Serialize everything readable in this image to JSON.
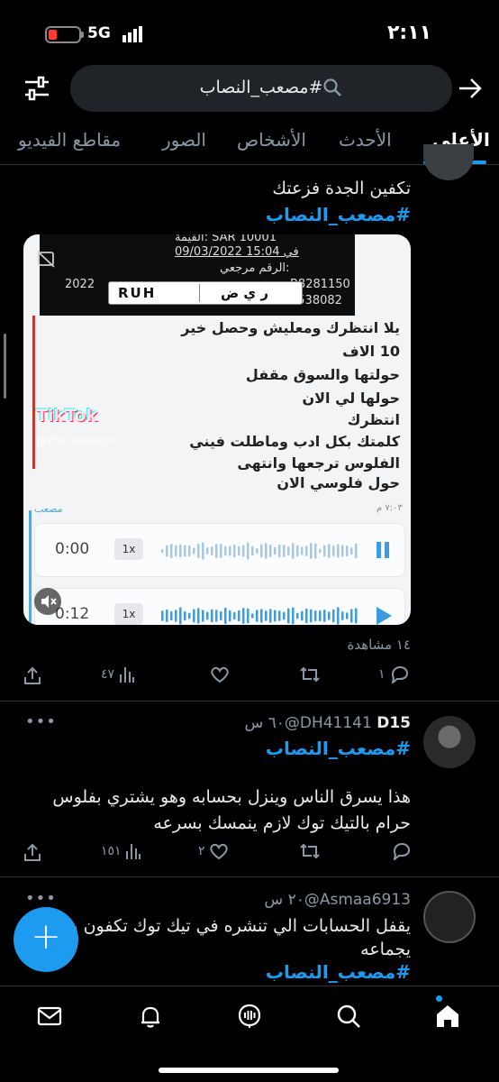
{
  "status": {
    "time": "٢:١١",
    "network": "5G"
  },
  "search": {
    "query": "#مصعب_النصاب"
  },
  "tabs": [
    {
      "label": "الأعلى"
    },
    {
      "label": "الأحدث"
    },
    {
      "label": "الأشخاص"
    },
    {
      "label": "الصور"
    },
    {
      "label": "مقاطع الفيديو"
    }
  ],
  "tweet1": {
    "text": "تكفين الجدة فزعتك",
    "hashtag": "#مصعب_النصاب",
    "media": {
      "receipt_lines": [
        "القيمة: SAR 10001",
        "في 15:04 09/03/2022",
        "الرقم مرجعي:",
        "B8281150",
        "4538082"
      ],
      "plate_year": "2022",
      "plate_latin": "RUH",
      "plate_arabic": "ر ي ض",
      "chat_lines": [
        "يلا انتظرك ومعليش وحصل خير",
        "10 الاف",
        "حولتها والسوق مقفل",
        "حولها لي الان",
        "انتظرك",
        "كلمتك بكل ادب وماطلت فيني",
        "الفلوس ترجعها وانتهى",
        "حول فلوسي الان"
      ],
      "watermark": "TikTok",
      "watermark_user": "@zhir.dilaaajmi",
      "chat_sender": "مصعب",
      "chat_time": "٧:٠٣ م",
      "voice_notes": [
        {
          "time": "0:00",
          "speed": "1x",
          "state": "pause"
        },
        {
          "time": "0:12",
          "speed": "1x",
          "state": "play"
        }
      ]
    },
    "views": "١٤ مشاهدة",
    "actions": {
      "replies": "١",
      "retweets": "",
      "likes": "",
      "views": "٤٧"
    }
  },
  "tweet2": {
    "name": "D15",
    "handle": "@DH41141",
    "time": "٦٠ س",
    "hashtag": "#مصعب_النصاب",
    "text_line1": "هذا يسرق الناس وينزل بحسابه وهو يشتري بفلوس",
    "text_line2": "حرام بالتيك توك لازم ينمسك بسرعه",
    "actions": {
      "replies": "",
      "retweets": "",
      "likes": "٢",
      "views": "١٥١"
    }
  },
  "tweet3": {
    "handle": "@Asmaa6913",
    "time": "٢٠ س",
    "text_line1": "يقفل الحسابات الي تنشره في تيك توك تكفون يد",
    "text_line2": "يجماعه",
    "hashtag": "#مصعب_النصاب"
  },
  "fab": {
    "label": "+"
  },
  "colors": {
    "accent": "#1d9bf0",
    "background": "#000000",
    "muted": "#8b98a5"
  }
}
